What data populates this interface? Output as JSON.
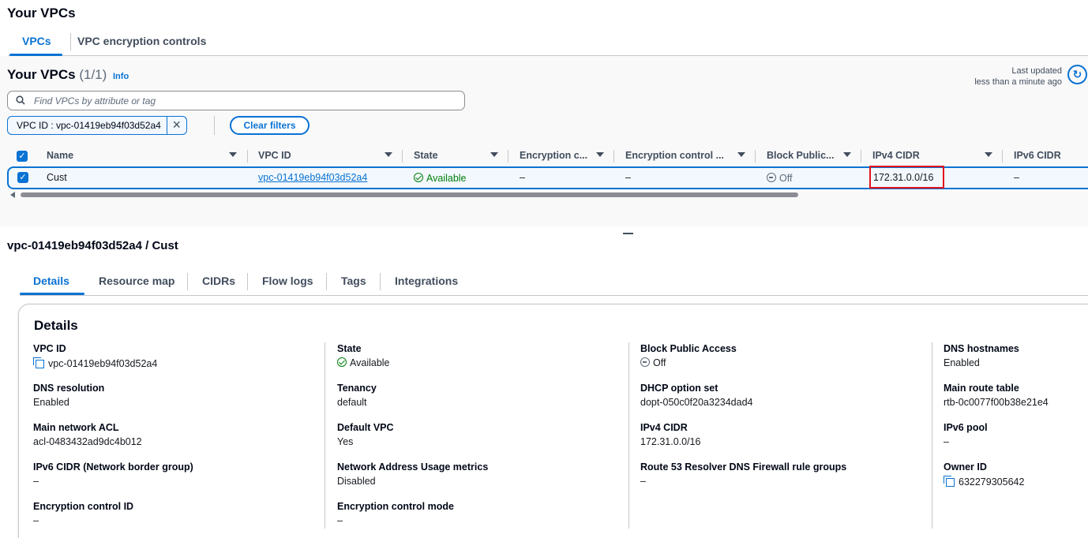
{
  "page_title": "Your VPCs",
  "top_tabs": [
    {
      "label": "VPCs",
      "active": true
    },
    {
      "label": "VPC encryption controls",
      "active": false
    }
  ],
  "list": {
    "title": "Your VPCs",
    "count": "(1/1)",
    "info": "Info",
    "last_updated_label": "Last updated",
    "last_updated_value": "less than a minute ago",
    "refresh_icon": "refresh-icon",
    "search_placeholder": "Find VPCs by attribute or tag",
    "filter_token": "VPC ID : vpc-01419eb94f03d52a4",
    "clear_filters": "Clear filters",
    "columns": [
      "Name",
      "VPC ID",
      "State",
      "Encryption c...",
      "Encryption control ...",
      "Block Public...",
      "IPv4 CIDR",
      "IPv6 CIDR"
    ],
    "row": {
      "name": "Cust",
      "vpc_id": "vpc-01419eb94f03d52a4",
      "state": "Available",
      "encryption_c": "–",
      "encryption_control": "–",
      "block_public": "Off",
      "ipv4_cidr": "172.31.0.0/16",
      "ipv6_cidr": "–"
    },
    "highlight_color": "#e0141e"
  },
  "detail": {
    "title": "vpc-01419eb94f03d52a4 / Cust",
    "tabs": [
      "Details",
      "Resource map",
      "CIDRs",
      "Flow logs",
      "Tags",
      "Integrations"
    ],
    "card_title": "Details",
    "columns": [
      [
        {
          "label": "VPC ID",
          "value": "vpc-01419eb94f03d52a4"
        },
        {
          "label": "DNS resolution",
          "value": "Enabled"
        },
        {
          "label": "Main network ACL",
          "value": "acl-0483432ad9dc4b012"
        },
        {
          "label": "IPv6 CIDR (Network border group)",
          "value": "–"
        },
        {
          "label": "Encryption control ID",
          "value": "–"
        }
      ],
      [
        {
          "label": "State",
          "value": "Available"
        },
        {
          "label": "Tenancy",
          "value": "default"
        },
        {
          "label": "Default VPC",
          "value": "Yes"
        },
        {
          "label": "Network Address Usage metrics",
          "value": "Disabled"
        },
        {
          "label": "Encryption control mode",
          "value": "–"
        }
      ],
      [
        {
          "label": "Block Public Access",
          "value": "Off"
        },
        {
          "label": "DHCP option set",
          "value": "dopt-050c0f20a3234dad4"
        },
        {
          "label": "IPv4 CIDR",
          "value": "172.31.0.0/16"
        },
        {
          "label": "Route 53 Resolver DNS Firewall rule groups",
          "value": "–"
        }
      ],
      [
        {
          "label": "DNS hostnames",
          "value": "Enabled"
        },
        {
          "label": "Main route table",
          "value": "rtb-0c0077f00b38e21e4"
        },
        {
          "label": "IPv6 pool",
          "value": "–"
        },
        {
          "label": "Owner ID",
          "value": "632279305642"
        }
      ]
    ]
  },
  "colors": {
    "accent": "#0972d3",
    "success": "#037f0c",
    "text": "#16191f"
  }
}
